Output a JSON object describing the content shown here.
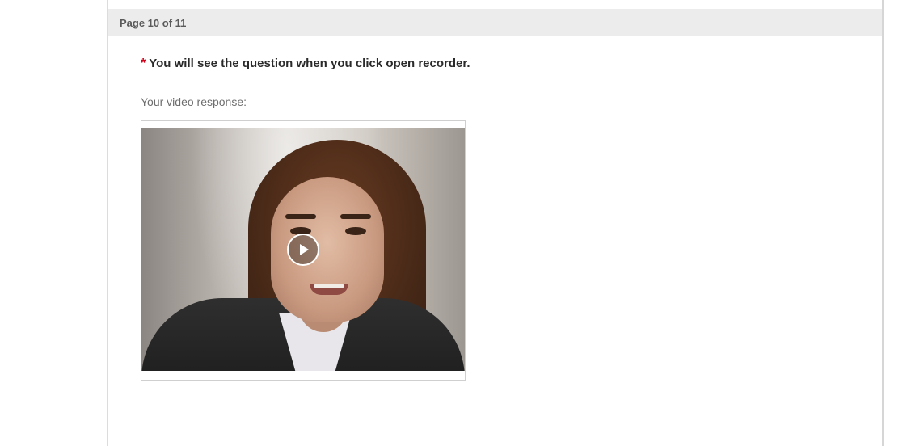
{
  "page_header": {
    "text": "Page 10 of 11"
  },
  "question": {
    "required_marker": "*",
    "text": "You will see the question when you click open recorder."
  },
  "video_response": {
    "label": "Your video response:",
    "play_icon": "play-icon"
  },
  "colors": {
    "header_bg": "#ececec",
    "required_star": "#d0021b"
  }
}
